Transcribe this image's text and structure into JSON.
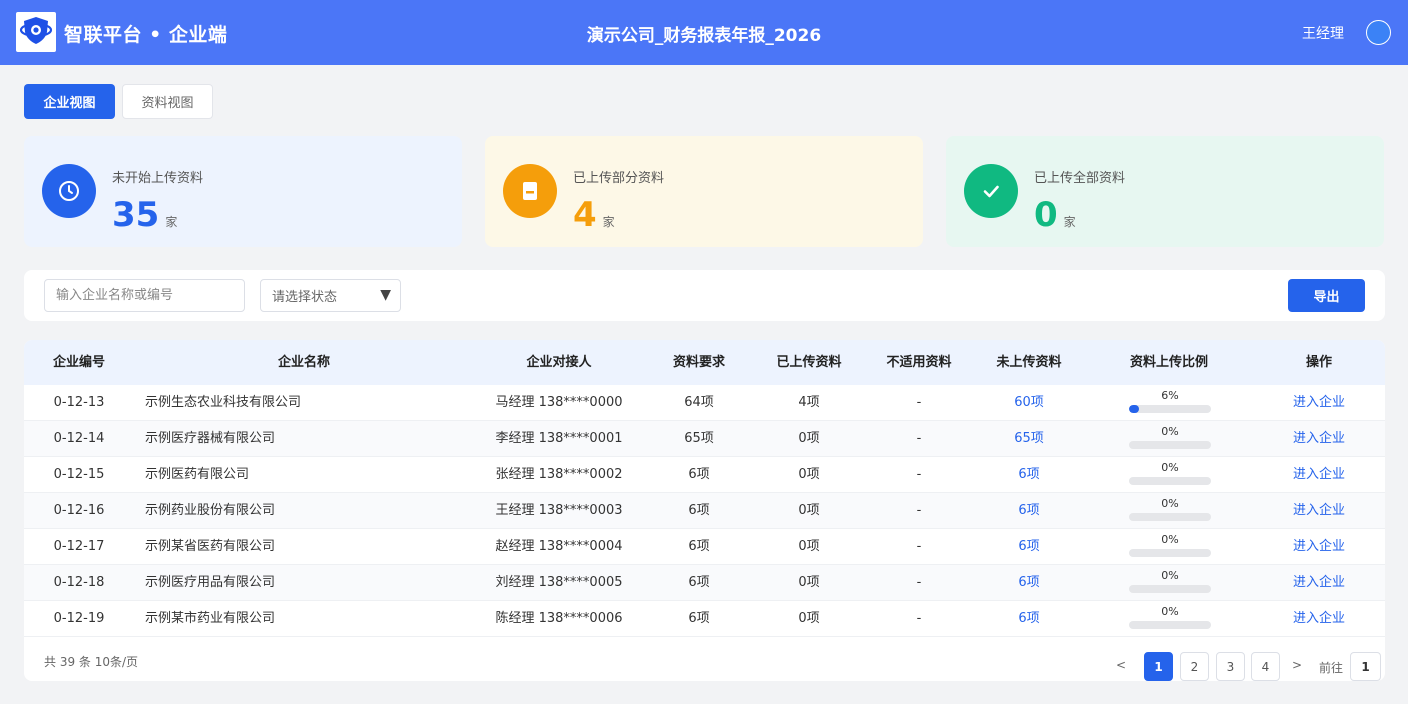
{
  "header": {
    "brand": "智联平台 • 企业端",
    "title": "演示公司_财务报表年报_2026",
    "user_name": "王经理"
  },
  "tabs": [
    {
      "label": "企业视图",
      "active": true
    },
    {
      "label": "资料视图",
      "active": false
    }
  ],
  "stats": [
    {
      "label": "未开始上传资料",
      "value": "35",
      "unit": "家",
      "color": "#2563eb",
      "icon": "clock-icon"
    },
    {
      "label": "已上传部分资料",
      "value": "4",
      "unit": "家",
      "color": "#f59e0b",
      "icon": "document-icon"
    },
    {
      "label": "已上传全部资料",
      "value": "0",
      "unit": "家",
      "color": "#10b981",
      "icon": "check-icon"
    }
  ],
  "filters": {
    "search_placeholder": "输入企业名称或编号",
    "status_placeholder": "请选择状态",
    "export_label": "导出"
  },
  "table": {
    "columns": [
      "企业编号",
      "企业名称",
      "企业对接人",
      "资料要求",
      "已上传资料",
      "不适用资料",
      "未上传资料",
      "资料上传比例",
      "操作"
    ],
    "rows": [
      {
        "id": "0-12-13",
        "name": "示例生态农业科技有限公司",
        "contact": "马经理 138****0000",
        "required": "64项",
        "uploaded": "4项",
        "na": "-",
        "missing": "60项",
        "ratio_text": "6%",
        "ratio": 6,
        "action": "进入企业"
      },
      {
        "id": "0-12-14",
        "name": "示例医疗器械有限公司",
        "contact": "李经理 138****0001",
        "required": "65项",
        "uploaded": "0项",
        "na": "-",
        "missing": "65项",
        "ratio_text": "0%",
        "ratio": 0,
        "action": "进入企业"
      },
      {
        "id": "0-12-15",
        "name": "示例医药有限公司",
        "contact": "张经理 138****0002",
        "required": "6项",
        "uploaded": "0项",
        "na": "-",
        "missing": "6项",
        "ratio_text": "0%",
        "ratio": 0,
        "action": "进入企业"
      },
      {
        "id": "0-12-16",
        "name": "示例药业股份有限公司",
        "contact": "王经理 138****0003",
        "required": "6项",
        "uploaded": "0项",
        "na": "-",
        "missing": "6项",
        "ratio_text": "0%",
        "ratio": 0,
        "action": "进入企业"
      },
      {
        "id": "0-12-17",
        "name": "示例某省医药有限公司",
        "contact": "赵经理 138****0004",
        "required": "6项",
        "uploaded": "0项",
        "na": "-",
        "missing": "6项",
        "ratio_text": "0%",
        "ratio": 0,
        "action": "进入企业"
      },
      {
        "id": "0-12-18",
        "name": "示例医疗用品有限公司",
        "contact": "刘经理 138****0005",
        "required": "6项",
        "uploaded": "0项",
        "na": "-",
        "missing": "6项",
        "ratio_text": "0%",
        "ratio": 0,
        "action": "进入企业"
      },
      {
        "id": "0-12-19",
        "name": "示例某市药业有限公司",
        "contact": "陈经理 138****0006",
        "required": "6项",
        "uploaded": "0项",
        "na": "-",
        "missing": "6项",
        "ratio_text": "0%",
        "ratio": 0,
        "action": "进入企业"
      }
    ]
  },
  "pagination": {
    "total_text": "共 39 条 10条/页",
    "prev": "<",
    "next": ">",
    "pages": [
      "1",
      "2",
      "3",
      "4"
    ],
    "current": "1",
    "goto_label": "前往",
    "goto_value": "1"
  }
}
